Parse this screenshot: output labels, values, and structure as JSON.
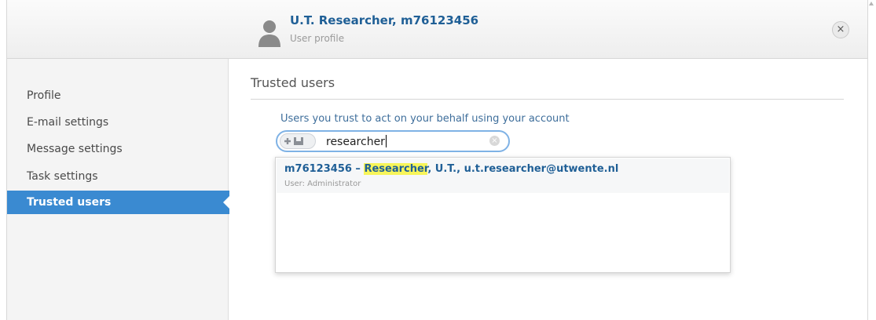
{
  "header": {
    "title": "U.T. Researcher, m76123456",
    "subtitle": "User profile",
    "close_glyph": "×"
  },
  "sidebar": {
    "items": [
      {
        "label": "Profile"
      },
      {
        "label": "E-mail settings"
      },
      {
        "label": "Message settings"
      },
      {
        "label": "Task settings"
      },
      {
        "label": "Trusted users",
        "active": true
      }
    ]
  },
  "main": {
    "section_title": "Trusted users",
    "helper_text": "Users you trust to act on your behalf using your account",
    "search": {
      "value": "researcher",
      "add_button_icon": "add-user-icon",
      "clear_glyph": "×"
    },
    "results": [
      {
        "id_prefix": "m76123456 – ",
        "match": "Researcher",
        "rest": ", U.T., u.t.researcher@utwente.nl",
        "role": "User: Administrator"
      }
    ]
  },
  "colors": {
    "accent": "#3a8ad1",
    "link": "#1f5f96",
    "highlight": "#f7f55a"
  }
}
